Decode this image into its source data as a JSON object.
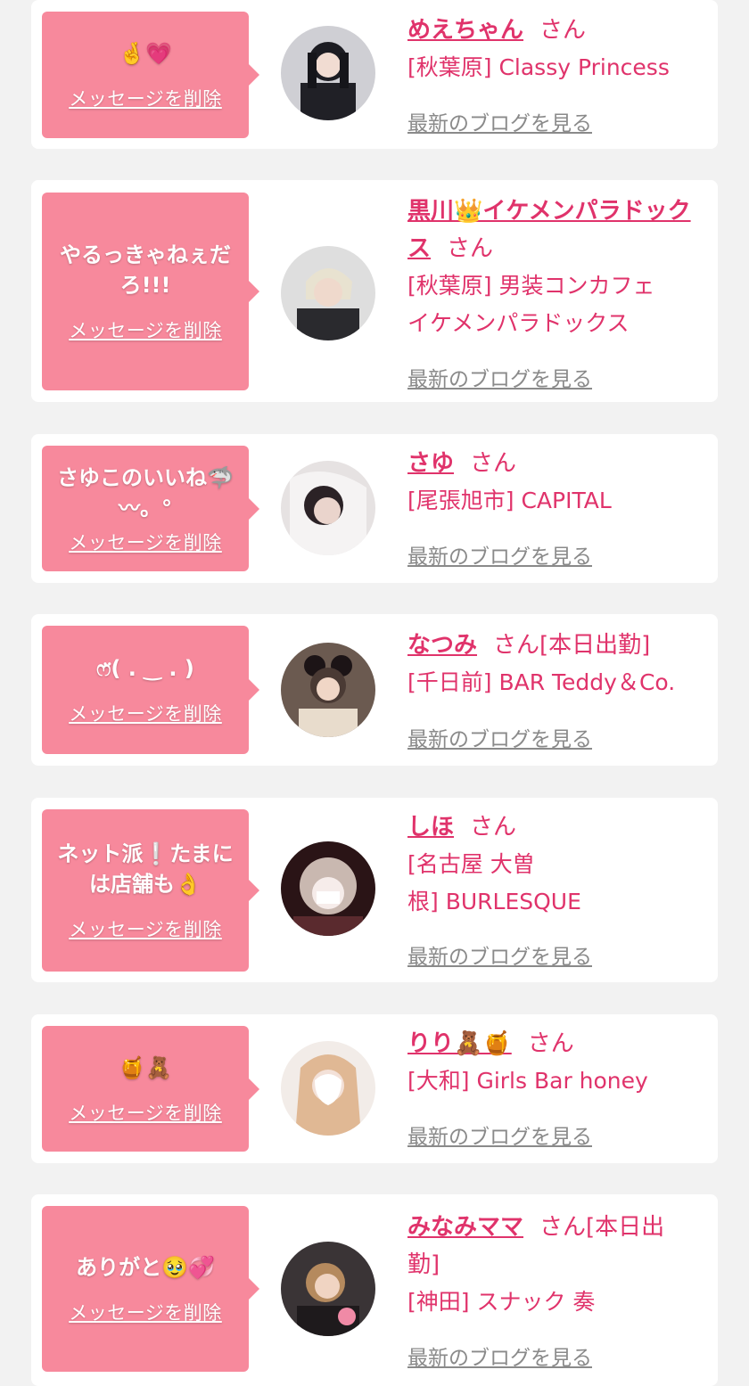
{
  "delete_label": "メッセージを削除",
  "blog_label": "最新のブログを見る",
  "san_label": "さん",
  "colors": {
    "accent": "#e0336b",
    "bubble": "#f7899c",
    "background": "#f2f2f2",
    "card": "#ffffff",
    "link_gray": "#8a8a8a"
  },
  "entries": [
    {
      "message": "🤞💗",
      "name": "めえちゃん",
      "status": "",
      "shop_lines": [
        "[秋葉原] Classy Princess"
      ]
    },
    {
      "message": "やるっきゃねぇだろ!!!",
      "name": "黒川👑イケメンパラドックス",
      "status": "",
      "shop_lines": [
        "[秋葉原] 男装コンカフェ",
        "イケメンパラドックス"
      ]
    },
    {
      "message": "さゆこのいいね🦈〰。°",
      "name": "さゆ",
      "status": "",
      "shop_lines": [
        "[尾張旭市] CAPITAL"
      ]
    },
    {
      "message": "ෆ̈( . ‿ . )",
      "name": "なつみ",
      "status": "[本日出勤]",
      "shop_lines": [
        "[千日前] BAR Teddy＆Co."
      ]
    },
    {
      "message": "ネット派❕たまには店舗も👌",
      "name": "しほ",
      "status": "",
      "shop_lines": [
        "[名古屋 大曽",
        "根] BURLESQUE"
      ]
    },
    {
      "message": "🍯🧸",
      "name": "りり🧸🍯",
      "status": "",
      "shop_lines": [
        "[大和] Girls Bar honey"
      ]
    },
    {
      "message": "ありがと🥹💞",
      "name": "みなみママ",
      "status": "[本日出勤]",
      "shop_lines": [
        "[神田] スナック 奏"
      ]
    }
  ]
}
